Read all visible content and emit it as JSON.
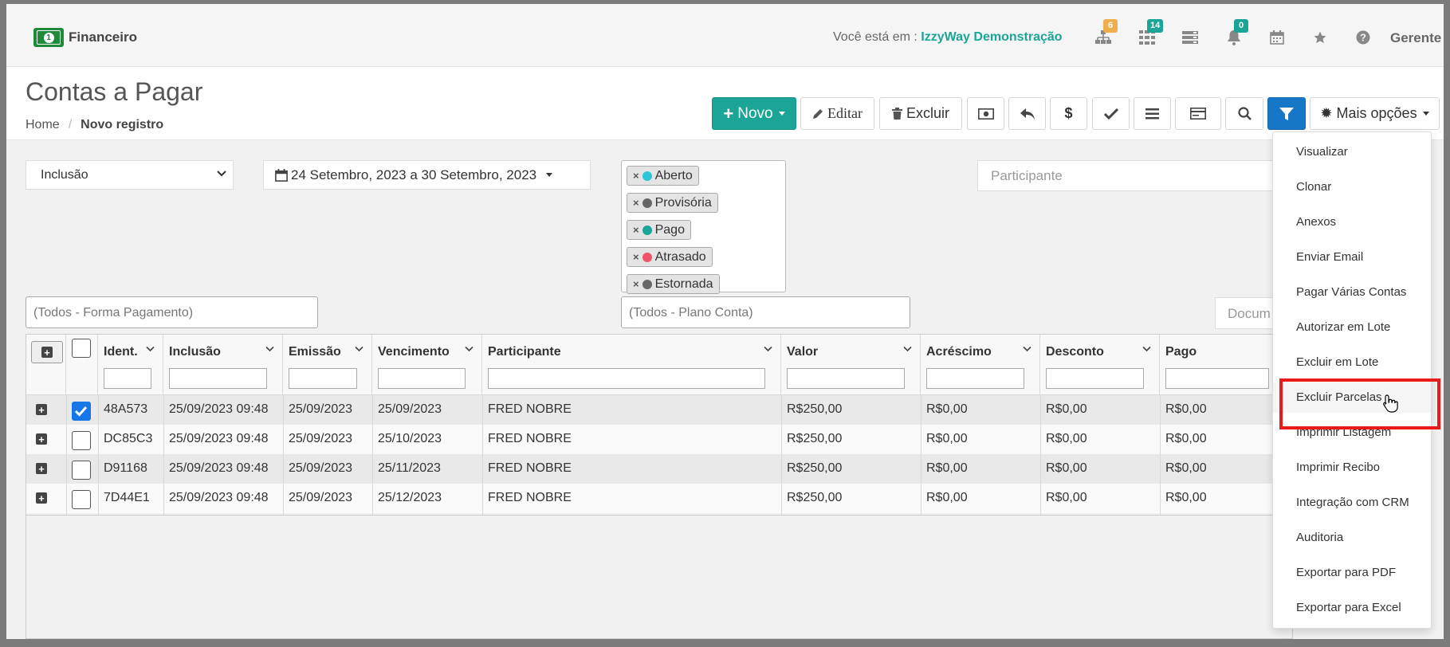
{
  "app": {
    "name": "Financeiro"
  },
  "header": {
    "you_are_label": "Você está em :",
    "company": "IzzyWay Demonstração",
    "badges": {
      "sitemap": "6",
      "grid": "14",
      "bell": "0"
    },
    "user": "Gerente"
  },
  "page": {
    "title": "Contas a Pagar",
    "breadcrumb": {
      "home": "Home",
      "current": "Novo registro"
    }
  },
  "toolbar": {
    "novo": "Novo",
    "editar": "Editar",
    "excluir": "Excluir",
    "mais_opcoes": "Mais opções"
  },
  "filters": {
    "date_type": "Inclusão",
    "date_range": "24 Setembro, 2023 a 30 Setembro, 2023",
    "status_tags": [
      {
        "label": "Aberto",
        "color": "#2cc6d8"
      },
      {
        "label": "Provisória",
        "color": "#666666"
      },
      {
        "label": "Pago",
        "color": "#1aa596"
      },
      {
        "label": "Atrasado",
        "color": "#ee5566"
      },
      {
        "label": "Estornada",
        "color": "#666666"
      }
    ],
    "participante_placeholder": "Participante",
    "forma_pagamento_placeholder": "(Todos - Forma Pagamento)",
    "plano_conta_placeholder": "(Todos - Plano Conta)",
    "documento_placeholder": "Docum"
  },
  "grid": {
    "columns": [
      "Ident.",
      "Inclusão",
      "Emissão",
      "Vencimento",
      "Participante",
      "Valor",
      "Acréscimo",
      "Desconto",
      "Pago"
    ],
    "rows": [
      {
        "ident": "48A573",
        "inclusao": "25/09/2023 09:48",
        "emissao": "25/09/2023",
        "vencimento": "25/09/2023",
        "participante": "FRED NOBRE",
        "valor": "R$250,00",
        "acrescimo": "R$0,00",
        "desconto": "R$0,00",
        "pago": "R$0,00",
        "checked": true
      },
      {
        "ident": "DC85C3",
        "inclusao": "25/09/2023 09:48",
        "emissao": "25/09/2023",
        "vencimento": "25/10/2023",
        "participante": "FRED NOBRE",
        "valor": "R$250,00",
        "acrescimo": "R$0,00",
        "desconto": "R$0,00",
        "pago": "R$0,00",
        "checked": false
      },
      {
        "ident": "D91168",
        "inclusao": "25/09/2023 09:48",
        "emissao": "25/09/2023",
        "vencimento": "25/11/2023",
        "participante": "FRED NOBRE",
        "valor": "R$250,00",
        "acrescimo": "R$0,00",
        "desconto": "R$0,00",
        "pago": "R$0,00",
        "checked": false
      },
      {
        "ident": "7D44E1",
        "inclusao": "25/09/2023 09:48",
        "emissao": "25/09/2023",
        "vencimento": "25/12/2023",
        "participante": "FRED NOBRE",
        "valor": "R$250,00",
        "acrescimo": "R$0,00",
        "desconto": "R$0,00",
        "pago": "R$0,00",
        "checked": false
      }
    ]
  },
  "dropdown": {
    "items": [
      "Visualizar",
      "Clonar",
      "Anexos",
      "Enviar Email",
      "Pagar Várias Contas",
      "Autorizar em Lote",
      "Excluir em Lote",
      "Excluir Parcelas",
      "Imprimir Listagem",
      "Imprimir Recibo",
      "Integração com CRM",
      "Auditoria",
      "Exportar para PDF",
      "Exportar para Excel"
    ],
    "highlighted": "Excluir Parcelas"
  },
  "colors": {
    "accent": "#1aa596",
    "primary": "#1677c8",
    "highlight": "#e81a1a"
  }
}
